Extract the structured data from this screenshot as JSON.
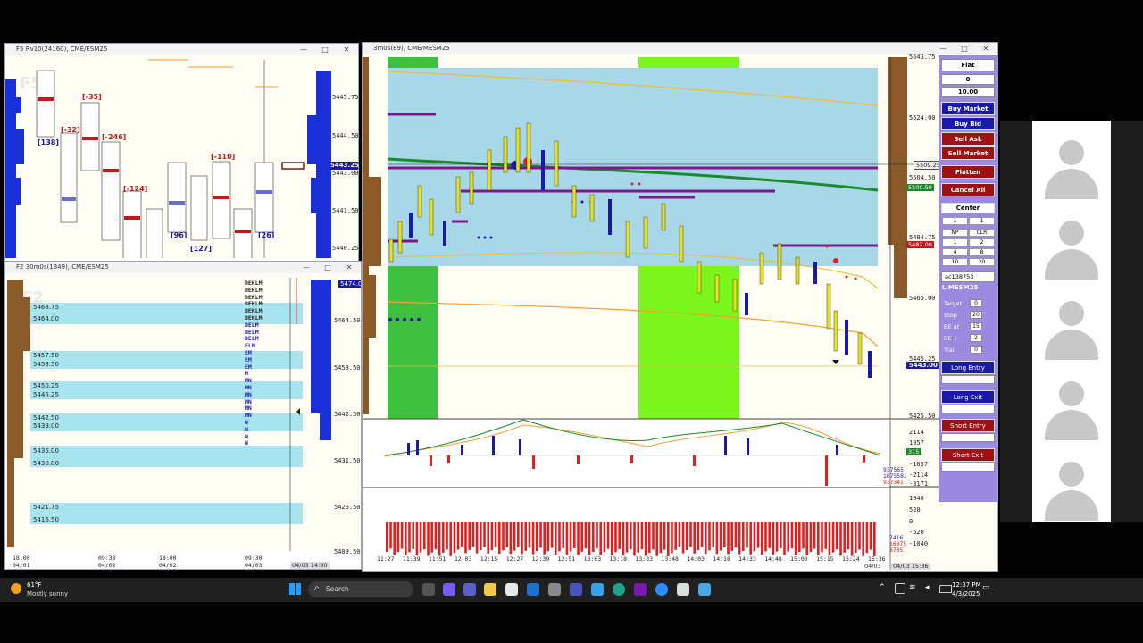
{
  "windows": {
    "top_left": {
      "title": "F5 Rv10(24160), CME/ESM25",
      "watermark": "F5",
      "prices": [
        "5445.75",
        "5444.50",
        "5443.00",
        "5441.50",
        "5440.25"
      ],
      "current_price": "5443.25",
      "deltas": [
        "[138]",
        "[-32]",
        "[-35]",
        "[-246]",
        "[-124]",
        "[96]",
        "[127]",
        "[-110]",
        "[26]"
      ]
    },
    "bottom_left": {
      "title": "F2 30m0s(1349), CME/ESM25",
      "watermark": "F2",
      "prices": [
        "5474.00",
        "5464.50",
        "5453.50",
        "5442.50",
        "5431.50",
        "5420.50",
        "5409.50"
      ],
      "levels": [
        "5468.75",
        "5464.00",
        "5457.50",
        "5453.50",
        "5450.25",
        "5446.25",
        "5442.50",
        "5439.00",
        "5435.00",
        "5430.00",
        "5421.75",
        "5416.50"
      ],
      "tpo_rows": [
        "DEKLM",
        "DEKLM",
        "DEKLM",
        "DEKLM",
        "DEKLM",
        "DEKLM",
        "DELM",
        "DELM",
        "DELM",
        "ELM",
        "EM",
        "EM",
        "EM",
        "M",
        "MN",
        "MN",
        "MN",
        "MN",
        "MN",
        "MN",
        "N",
        "N",
        "N",
        "N"
      ],
      "time_labels": [
        {
          "t": "18:00",
          "d": "04/01"
        },
        {
          "t": "09:30",
          "d": "04/02"
        },
        {
          "t": "18:00",
          "d": "04/02"
        },
        {
          "t": "09:30",
          "d": "04/03"
        }
      ],
      "cursor_time": "04/03 14:30"
    },
    "main": {
      "title": "3m0s(89), CME/MESM25",
      "prices": [
        "5543.75",
        "5524.00",
        "5504.50",
        "5484.75",
        "5465.00",
        "5445.25",
        "5425.50"
      ],
      "price_tags": [
        "5509.25",
        "5500.50",
        "5482.00",
        "5443.00"
      ],
      "osc_labels": [
        "2114",
        "1057",
        "315",
        "-1057",
        "-2114",
        "-3171"
      ],
      "osc_values": [
        "937565",
        "1875581",
        "937341"
      ],
      "vol_labels": [
        "1040",
        "520",
        "0",
        "-520",
        "-1040"
      ],
      "vol_values": [
        "7416",
        "16875",
        "8785"
      ],
      "time_labels": [
        "11:27",
        "11:39",
        "11:51",
        "12:03",
        "12:15",
        "12:27",
        "12:39",
        "12:51",
        "13:03",
        "13:18",
        "13:33",
        "13:48",
        "14:03",
        "14:18",
        "14:33",
        "14:48",
        "15:00",
        "15:15",
        "15:24",
        "15:36"
      ],
      "last_date": "04/03",
      "cursor_time": "04/03 15:36"
    }
  },
  "order_panel": {
    "position": "Flat",
    "pnl": "0",
    "qty": "10.00",
    "buttons": {
      "buy_market": "Buy Market",
      "buy_bid": "Buy Bid",
      "sell_ask": "Sell Ask",
      "sell_market": "Sell Market",
      "flatten": "Flatten",
      "cancel_all": "Cancel All",
      "center": "Center"
    },
    "grid": [
      [
        "1",
        "1"
      ],
      [
        "NP",
        "CLR"
      ],
      [
        "1",
        "2"
      ],
      [
        "4",
        "8"
      ],
      [
        "10",
        "20"
      ]
    ],
    "account": "ac138753",
    "symbol": "L MESM25",
    "params": [
      {
        "label": "Target",
        "value": "0"
      },
      {
        "label": "Stop",
        "value": "20"
      },
      {
        "label": "BE at",
        "value": "15"
      },
      {
        "label": "BE +",
        "value": "2"
      },
      {
        "label": "Trail",
        "value": "0"
      }
    ],
    "strategy_buttons": {
      "long_entry": "Long Entry",
      "long_exit": "Long Exit",
      "short_entry": "Short Entry",
      "short_exit": "Short Exit"
    }
  },
  "taskbar": {
    "weather_temp": "61°F",
    "weather_desc": "Mostly sunny",
    "search_placeholder": "Search",
    "time": "12:37 PM",
    "date": "4/3/2025"
  },
  "colors": {
    "buy": "#1a1aa8",
    "sell": "#c01a1a",
    "panel": "#9b8adf",
    "value_area": "#a8d8e8",
    "session_green": "#3fc13f",
    "session_lime": "#7cf51c"
  }
}
